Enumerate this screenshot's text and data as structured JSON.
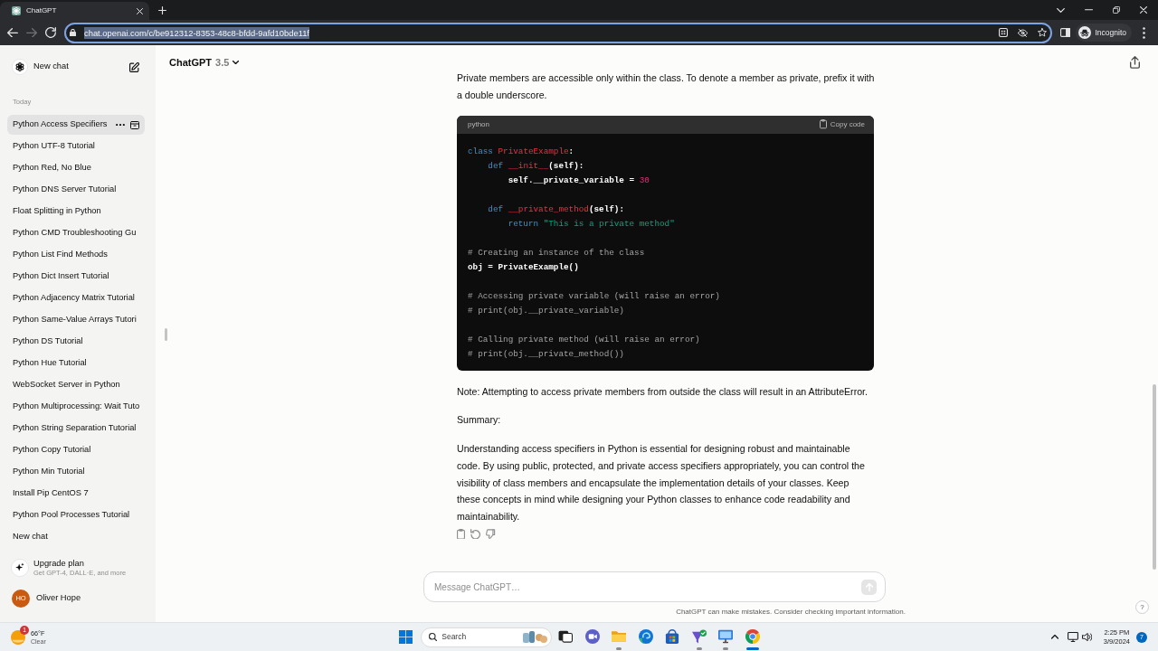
{
  "browser": {
    "tab": {
      "title": "ChatGPT"
    },
    "nav": [
      {
        "kind": "back",
        "disabled": false
      },
      {
        "kind": "forward",
        "disabled": true
      },
      {
        "kind": "reload",
        "disabled": false
      }
    ],
    "url": "chat.openai.com/c/be912312-8353-48c8-bfdd-9afd10bde11f",
    "url_selected": true,
    "profile": "Incognito"
  },
  "sidebar": {
    "new_chat": "New chat",
    "section": "Today",
    "items": [
      {
        "title": "Python Access Specifiers",
        "selected": true
      },
      {
        "title": "Python UTF-8 Tutorial",
        "selected": false
      },
      {
        "title": "Python Red, No Blue",
        "selected": false
      },
      {
        "title": "Python DNS Server Tutorial",
        "selected": false
      },
      {
        "title": "Float Splitting in Python",
        "selected": false
      },
      {
        "title": "Python CMD Troubleshooting Gu",
        "selected": false
      },
      {
        "title": "Python List Find Methods",
        "selected": false
      },
      {
        "title": "Python Dict Insert Tutorial",
        "selected": false
      },
      {
        "title": "Python Adjacency Matrix Tutorial",
        "selected": false
      },
      {
        "title": "Python Same-Value Arrays Tutori",
        "selected": false
      },
      {
        "title": "Python DS Tutorial",
        "selected": false
      },
      {
        "title": "Python Hue Tutorial",
        "selected": false
      },
      {
        "title": "WebSocket Server in Python",
        "selected": false
      },
      {
        "title": "Python Multiprocessing: Wait Tuto",
        "selected": false
      },
      {
        "title": "Python String Separation Tutorial",
        "selected": false
      },
      {
        "title": "Python Copy Tutorial",
        "selected": false
      },
      {
        "title": "Python Min Tutorial",
        "selected": false
      },
      {
        "title": "Install Pip CentOS 7",
        "selected": false
      },
      {
        "title": "Python Pool Processes Tutorial",
        "selected": false
      },
      {
        "title": "New chat",
        "selected": false
      }
    ],
    "upgrade": {
      "title": "Upgrade plan",
      "subtitle": "Get GPT-4, DALL·E, and more"
    },
    "user": {
      "initials": "HO",
      "name": "Oliver Hope"
    }
  },
  "header": {
    "title": "ChatGPT",
    "version": "3.5"
  },
  "message": {
    "blocks": [
      {
        "kind": "paragraph",
        "text": "Private members are accessible only within the class. To denote a member as private, prefix it with a double underscore."
      },
      {
        "kind": "code",
        "language": "python",
        "copy_label": "Copy code",
        "groups": [
          {
            "lines": [
              {
                "tokens": [
                  {
                    "text": "class ",
                    "kind": "keyword"
                  },
                  {
                    "text": "PrivateExample",
                    "kind": "title"
                  },
                  {
                    "text": ":",
                    "kind": "plain"
                  }
                ]
              },
              {
                "tokens": [
                  {
                    "text": "    def ",
                    "kind": "keyword"
                  },
                  {
                    "text": "__init__",
                    "kind": "title"
                  },
                  {
                    "text": "(self):",
                    "kind": "plain"
                  }
                ]
              },
              {
                "tokens": [
                  {
                    "text": "        self.__private_variable = ",
                    "kind": "plain"
                  },
                  {
                    "text": "30",
                    "kind": "number"
                  }
                ]
              }
            ]
          },
          {
            "lines": [
              {
                "tokens": [
                  {
                    "text": "    def ",
                    "kind": "keyword"
                  },
                  {
                    "text": "__private_method",
                    "kind": "title"
                  },
                  {
                    "text": "(self):",
                    "kind": "plain"
                  }
                ]
              },
              {
                "tokens": [
                  {
                    "text": "        return ",
                    "kind": "keyword"
                  },
                  {
                    "text": "\"This is a private method\"",
                    "kind": "string"
                  }
                ]
              }
            ]
          },
          {
            "lines": [
              {
                "tokens": [
                  {
                    "text": "# Creating an instance of the class",
                    "kind": "comment"
                  }
                ]
              },
              {
                "tokens": [
                  {
                    "text": "obj = PrivateExample()",
                    "kind": "plain"
                  }
                ]
              }
            ]
          },
          {
            "lines": [
              {
                "tokens": [
                  {
                    "text": "# Accessing private variable (will raise an error)",
                    "kind": "comment"
                  }
                ]
              },
              {
                "tokens": [
                  {
                    "text": "# print(obj.__private_variable)",
                    "kind": "comment"
                  }
                ]
              }
            ]
          },
          {
            "lines": [
              {
                "tokens": [
                  {
                    "text": "# Calling private method (will raise an error)",
                    "kind": "comment"
                  }
                ]
              },
              {
                "tokens": [
                  {
                    "text": "# print(obj.__private_method())",
                    "kind": "comment"
                  }
                ]
              }
            ]
          }
        ]
      },
      {
        "kind": "paragraph",
        "text": "Note: Attempting to access private members from outside the class will result in an AttributeError."
      },
      {
        "kind": "paragraph",
        "text": "Summary:"
      },
      {
        "kind": "paragraph",
        "text": "Understanding access specifiers in Python is essential for designing robust and maintainable code. By using public, protected, and private access specifiers appropriately, you can control the visibility of class members and encapsulate the implementation details of your classes. Keep these concepts in mind while designing your Python classes to enhance code readability and maintainability."
      }
    ],
    "actions": [
      {
        "kind": "copy"
      },
      {
        "kind": "regenerate"
      },
      {
        "kind": "dislike"
      }
    ]
  },
  "composer": {
    "placeholder": "Message ChatGPT…",
    "disclaimer": "ChatGPT can make mistakes. Consider checking important information.",
    "help": "?"
  },
  "taskbar": {
    "weather": {
      "alerts": "1",
      "temperature": "66°F",
      "condition": "Clear"
    },
    "search": "Search",
    "apps": [
      {
        "kind": "taskview",
        "running": false,
        "active": false
      },
      {
        "kind": "chat",
        "running": false,
        "active": false
      },
      {
        "kind": "folder",
        "running": true,
        "active": false
      },
      {
        "kind": "swirl",
        "running": false,
        "active": false
      },
      {
        "kind": "store",
        "running": false,
        "active": false
      },
      {
        "kind": "funnel",
        "running": true,
        "active": false
      },
      {
        "kind": "monitor",
        "running": true,
        "active": false
      },
      {
        "kind": "browser",
        "running": true,
        "active": true
      }
    ],
    "time": "2:25 PM",
    "date": "3/9/2024",
    "notifications": "7"
  }
}
